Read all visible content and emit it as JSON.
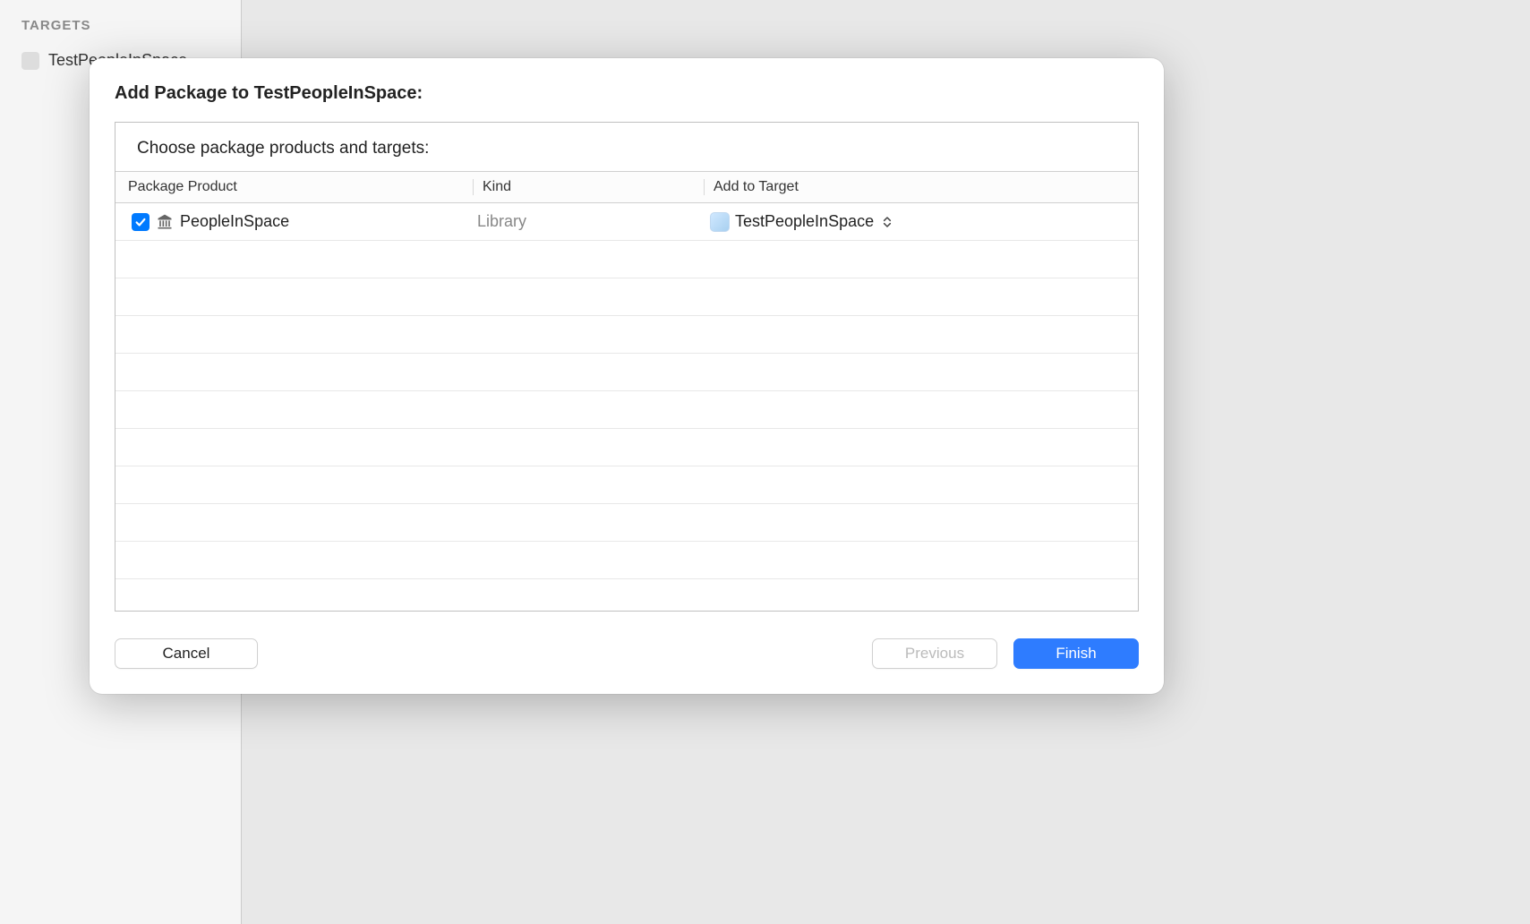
{
  "sidebar": {
    "header": "TARGETS",
    "item_label": "TestPeopleInSpace"
  },
  "modal": {
    "title": "Add Package to TestPeopleInSpace:",
    "subtitle": "Choose package products and targets:",
    "columns": {
      "product": "Package Product",
      "kind": "Kind",
      "target": "Add to Target"
    },
    "row": {
      "product": "PeopleInSpace",
      "kind": "Library",
      "target": "TestPeopleInSpace",
      "checked": true
    },
    "buttons": {
      "cancel": "Cancel",
      "previous": "Previous",
      "finish": "Finish"
    }
  }
}
